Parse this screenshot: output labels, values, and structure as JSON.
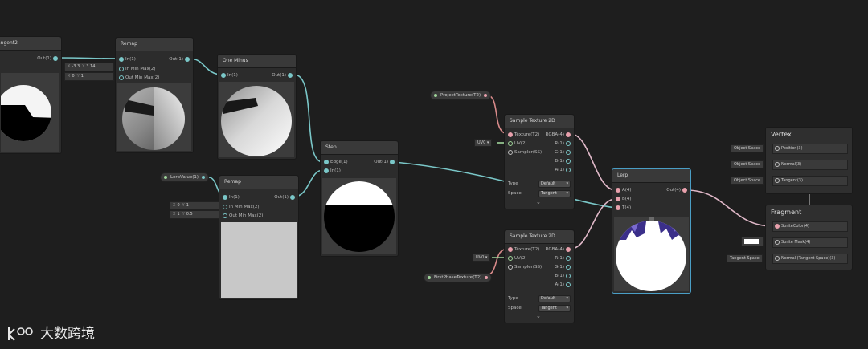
{
  "nodes": {
    "tangent": {
      "title": "angent2",
      "out": "Out(1)"
    },
    "remap1": {
      "title": "Remap",
      "in": "In(1)",
      "min": "In Min Max(2)",
      "out_min": "Out Min Max(2)",
      "out": "Out(1)"
    },
    "one_minus": {
      "title": "One Minus",
      "in": "In(1)",
      "out": "Out(1)"
    },
    "remap2": {
      "title": "Remap",
      "in": "In(1)",
      "min": "In Min Max(2)",
      "out_min": "Out Min Max(2)",
      "out": "Out(1)"
    },
    "step": {
      "title": "Step",
      "edge": "Edge(1)",
      "in": "In(1)",
      "out": "Out(1)"
    },
    "sample1": {
      "title": "Sample Texture 2D",
      "texture": "Texture(T2)",
      "uv": "UV(2)",
      "sampler": "Sampler(SS)",
      "rgba": "RGBA(4)",
      "r": "R(1)",
      "g": "G(1)",
      "b": "B(1)",
      "a": "A(1)",
      "type_label": "Type",
      "type_value": "Default",
      "space_label": "Space",
      "space_value": "Tangent"
    },
    "sample2": {
      "title": "Sample Texture 2D",
      "texture": "Texture(T2)",
      "uv": "UV(2)",
      "sampler": "Sampler(SS)",
      "rgba": "RGBA(4)",
      "r": "R(1)",
      "g": "G(1)",
      "b": "B(1)",
      "a": "A(1)",
      "type_label": "Type",
      "type_value": "Default",
      "space_label": "Space",
      "space_value": "Tangent"
    },
    "lerp": {
      "title": "Lerp",
      "a": "A(4)",
      "b": "B(4)",
      "t": "T(4)",
      "out": "Out(4)"
    }
  },
  "inputs": {
    "remap1_min_x": "X",
    "remap1_min_xv": "-3.3",
    "remap1_min_y": "Y",
    "remap1_min_yv": "3.14",
    "remap1_out_x": "X",
    "remap1_out_xv": "0",
    "remap1_out_y": "Y",
    "remap1_out_yv": "1",
    "remap2_min_x": "X",
    "remap2_min_xv": "0",
    "remap2_min_y": "Y",
    "remap2_min_yv": "1",
    "remap2_out_x": "X",
    "remap2_out_xv": "1",
    "remap2_out_y": "Y",
    "remap2_out_yv": "0.5",
    "uv0": "UV0",
    "uv0b": "UV0"
  },
  "properties": {
    "lerp_value": "LerpValue(1)",
    "project_texture": "ProjectTexture(T2)",
    "first_phase_texture": "FirstPhaseTexture(T2)"
  },
  "master": {
    "vertex_title": "Vertex",
    "vertex_slots": [
      "Position(3)",
      "Normal(3)",
      "Tangent(3)"
    ],
    "vertex_spaces": [
      "Object Space",
      "Object Space",
      "Object Space"
    ],
    "fragment_title": "Fragment",
    "fragment_slots": [
      "SpriteColor(4)",
      "Sprite Mask(4)",
      "Normal (Tangent Space)(3)"
    ],
    "fragment_normal_space": "Tangent Space"
  },
  "watermark": "大数跨境"
}
